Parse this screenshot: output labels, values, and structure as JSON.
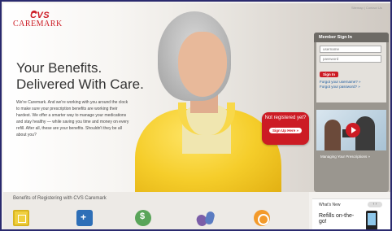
{
  "brand": {
    "logo_top": "CVS",
    "logo_bottom": "CAREMARK",
    "accent_color": "#cc1b24",
    "link_color": "#1a5a9e"
  },
  "hero": {
    "headline_line1": "Your Benefits.",
    "headline_line2": "Delivered With Care.",
    "intro": "We're Caremark. And we're working with you around the clock to make sure your prescription benefits are working their hardest. We offer a smarter way to manage your medications and stay healthy — while saving you time and money on every refill. After all, these are your benefits. Shouldn't they be all about you?"
  },
  "not_registered": {
    "text": "Not registered yet?",
    "button": "Sign Up Here »"
  },
  "signin": {
    "title": "Member Sign In",
    "username_placeholder": "username",
    "password_placeholder": "password",
    "button": "Sign In",
    "forgot_username": "Forgot your username? »",
    "forgot_password": "Forgot your password? »"
  },
  "video": {
    "icon": "play-icon",
    "caption": "Managing Your Prescriptions »"
  },
  "benefits": {
    "title": "Benefits of Registering with CVS Caremark",
    "icons": [
      "document-icon",
      "medical-kit-icon",
      "money-icon",
      "pill-capsule-icon",
      "search-icon"
    ]
  },
  "whats_new": {
    "title": "What's New",
    "pager": "‹ ›",
    "headline": "Refills on-the-go!",
    "icon": "smartphone-icon"
  },
  "top_right": "Sitemap | Contact Us"
}
